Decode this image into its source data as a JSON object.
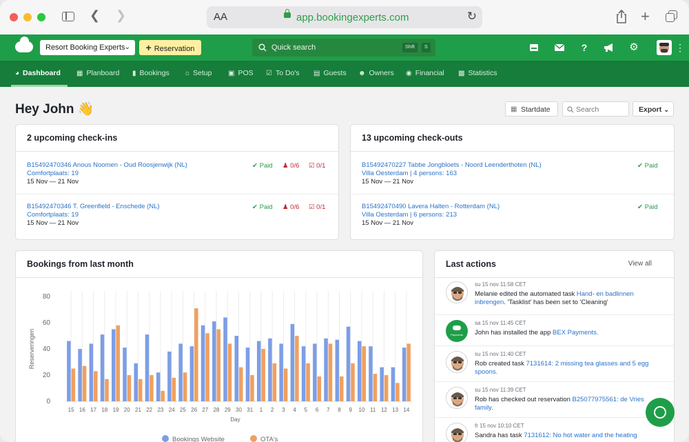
{
  "browser": {
    "aa_label": "AA",
    "url": "app.bookingexperts.com"
  },
  "appbar": {
    "property_selector": "Resort Booking Experts",
    "reservation_button": "Reservation",
    "quick_search_placeholder": "Quick search",
    "shortcut_keys": [
      "Shift",
      "S"
    ]
  },
  "nav": {
    "items": [
      {
        "label": "Dashboard",
        "icon": "gauge-icon",
        "active": true
      },
      {
        "label": "Planboard",
        "icon": "calendar-icon"
      },
      {
        "label": "Bookings",
        "icon": "books-icon"
      },
      {
        "label": "Setup",
        "icon": "home-icon"
      },
      {
        "label": "POS",
        "icon": "cart-icon"
      },
      {
        "label": "To Do's",
        "icon": "checkbox-icon"
      },
      {
        "label": "Guests",
        "icon": "contact-card-icon"
      },
      {
        "label": "Owners",
        "icon": "users-icon"
      },
      {
        "label": "Financial",
        "icon": "piggy-bank-icon"
      },
      {
        "label": "Statistics",
        "icon": "bar-chart-icon"
      }
    ]
  },
  "greeting": "Hey John 👋",
  "toolbar": {
    "startdate": "Startdate",
    "search_placeholder": "Search",
    "export": "Export"
  },
  "checkins": {
    "title": "2 upcoming check-ins",
    "items": [
      {
        "link": "B15492470346 Anous Noomen - Oud Roosjenwijk (NL)",
        "place": "Comfortplaats: 19",
        "dates": "15 Nov — 21 Nov",
        "paid": "Paid",
        "guests": "0/6",
        "tasks": "0/1"
      },
      {
        "link": "B15492470346 T. Greenfield - Enschede (NL)",
        "place": "Comfortplaats: 19",
        "dates": "15 Nov — 21 Nov",
        "paid": "Paid",
        "guests": "0/6",
        "tasks": "0/1"
      }
    ]
  },
  "checkouts": {
    "title": "13 upcoming check-outs",
    "items": [
      {
        "link": "B15492470227 Tabbe Jongbloets - Noord Leenderthoten (NL)",
        "place": "Villa Oesterdam | 4 persons: 163",
        "dates": "15 Nov — 21 Nov",
        "paid": "Paid"
      },
      {
        "link": "B15492470490 Lavera Halten - Rotterdam (NL)",
        "place": "Villa Oesterdam | 6 persons: 213",
        "dates": "15 Nov — 21 Nov",
        "paid": "Paid"
      }
    ]
  },
  "bookings_card": {
    "title": "Bookings from last month"
  },
  "chart_data": {
    "type": "bar",
    "title": "Bookings from last month",
    "xlabel": "Day",
    "ylabel": "Reserveringen",
    "ylim": [
      0,
      80
    ],
    "yticks": [
      0,
      20,
      40,
      60,
      80
    ],
    "categories": [
      "15",
      "16",
      "17",
      "18",
      "19",
      "20",
      "21",
      "22",
      "23",
      "24",
      "25",
      "26",
      "27",
      "28",
      "29",
      "30",
      "31",
      "1",
      "2",
      "3",
      "4",
      "5",
      "6",
      "7",
      "8",
      "9",
      "10",
      "11",
      "12",
      "13",
      "14"
    ],
    "series": [
      {
        "name": "Bookings Website",
        "color": "#7d9ee6",
        "values": [
          46,
          40,
          44,
          51,
          55,
          41,
          29,
          51,
          22,
          38,
          44,
          42,
          58,
          61,
          64,
          50,
          41,
          46,
          48,
          44,
          59,
          42,
          44,
          48,
          47,
          57,
          46,
          42,
          26,
          26,
          41
        ]
      },
      {
        "name": "OTA's",
        "color": "#f0a060",
        "values": [
          25,
          27,
          23,
          17,
          58,
          20,
          17,
          20,
          8,
          18,
          22,
          71,
          52,
          55,
          44,
          26,
          20,
          40,
          29,
          25,
          50,
          29,
          19,
          44,
          19,
          29,
          42,
          21,
          20,
          14,
          44
        ]
      }
    ],
    "legend_position": "bottom"
  },
  "last_actions": {
    "title": "Last actions",
    "view_all": "View all",
    "items": [
      {
        "meta": "su 15 nov 11:58 CET",
        "pre": "Melanie edited the automated task ",
        "link": "Hand- en badlinnen inbrengen",
        "post": ". 'Tasklist' has been set to 'Cleaning'",
        "avatar": "memoji-avatar"
      },
      {
        "meta": "sa 15 nov 11:45 CET",
        "pre": "John has installed the app ",
        "link": "BEX Payments.",
        "post": "",
        "avatar": "payments-app-avatar",
        "avatar_text": "Payments"
      },
      {
        "meta": "su 15 nov 11:40 CET",
        "pre": "Rob created task ",
        "link": "7131614: 2 missing tea glasses and 5 egg spoons.",
        "post": "",
        "avatar": "memoji-avatar"
      },
      {
        "meta": "su 15 nov 11:39 CET",
        "pre": "Rob has checked out reservation ",
        "link": "B25077975561: de Vries family.",
        "post": "",
        "avatar": "memoji-avatar"
      },
      {
        "meta": "fr 15 nov 10:10 CET",
        "pre": "Sandra has task ",
        "link": "7131612: No hot water and the heating",
        "post": "",
        "avatar": "memoji-avatar"
      }
    ]
  }
}
